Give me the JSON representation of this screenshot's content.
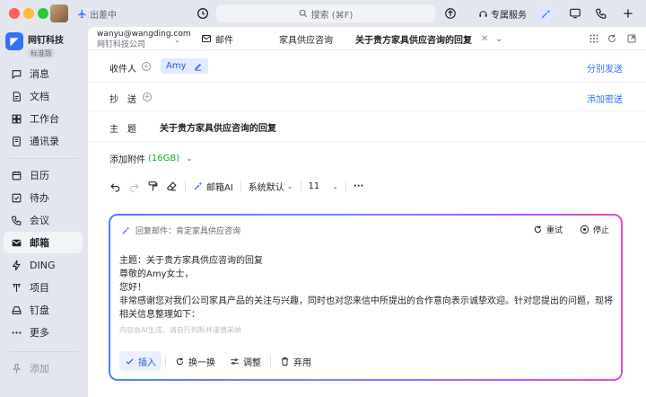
{
  "titlebar": {
    "status": "出差中",
    "search_placeholder": "搜索 (⌘F)",
    "service_label": "专属服务",
    "window_controls": {
      "close": "#ff5f57",
      "minimize": "#febc2e",
      "zoom": "#28c840"
    }
  },
  "org": {
    "name": "网钉科技",
    "tag": "标准版"
  },
  "sidebar": {
    "items": [
      {
        "label": "消息",
        "icon": "message-icon"
      },
      {
        "label": "文档",
        "icon": "document-icon"
      },
      {
        "label": "工作台",
        "icon": "workbench-icon"
      },
      {
        "label": "通讯录",
        "icon": "contacts-icon"
      },
      {
        "label": "日历",
        "icon": "calendar-icon"
      },
      {
        "label": "待办",
        "icon": "todo-icon"
      },
      {
        "label": "会议",
        "icon": "meeting-icon"
      },
      {
        "label": "邮箱",
        "icon": "mail-icon",
        "active": true
      },
      {
        "label": "DING",
        "icon": "ding-icon"
      },
      {
        "label": "项目",
        "icon": "project-icon"
      },
      {
        "label": "钉盘",
        "icon": "drive-icon"
      },
      {
        "label": "更多",
        "icon": "more-icon"
      }
    ],
    "add_label": "添加"
  },
  "account": {
    "email": "wanyu@wangding.com",
    "company": "网钉科技公司"
  },
  "tabs": {
    "mail": "邮件",
    "tab1": "家具供应咨询",
    "tab2": "关于贵方家具供应咨询的回复"
  },
  "compose": {
    "to_label": "收件人",
    "recipient": "Amy",
    "send_separately": "分别发送",
    "cc_label": "抄　送",
    "add_bcc": "添加密送",
    "subject_label": "主　题",
    "subject": "关于贵方家具供应咨询的回复",
    "attach_label": "添加附件",
    "attach_size": "(16GB)"
  },
  "toolbar": {
    "ai_label": "邮箱AI",
    "font": "系统默认",
    "size": "11",
    "more": "···"
  },
  "ai": {
    "header": "回复邮件：肯定家具供应咨询",
    "retry": "重试",
    "stop": "停止",
    "lines": [
      "主题：关于贵方家具供应咨询的回复",
      "尊敬的Amy女士，",
      "您好！",
      "非常感谢您对我们公司家具产品的关注与兴趣，同时也对您来信中所提出的合作意向表示诚挚欢迎。针对您提出的问题，现将",
      "相关信息整理如下："
    ],
    "note": "内容由AI生成，请自行判断并谨慎采纳",
    "insert": "插入",
    "swap": "换一换",
    "adjust": "调整",
    "discard": "弃用"
  },
  "colors": {
    "accent": "#3370ff",
    "active_nav_bg": "#f3f4f7",
    "sidebar_bg": "#e3e6ee"
  }
}
